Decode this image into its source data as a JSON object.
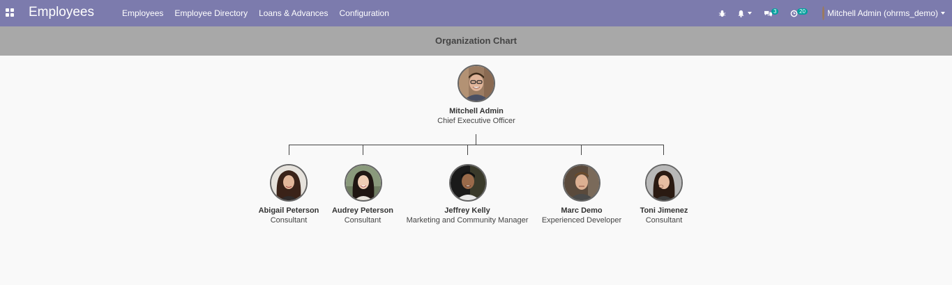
{
  "navbar": {
    "app_title": "Employees",
    "menu": [
      "Employees",
      "Employee Directory",
      "Loans & Advances",
      "Configuration"
    ],
    "messages_count": "3",
    "activities_count": "20",
    "user_label": "Mitchell Admin (ohrms_demo)",
    "icons": [
      "apps-grid-icon",
      "bug-icon",
      "bell-icon",
      "chat-bubbles-icon",
      "clock-icon",
      "user-avatar"
    ]
  },
  "control_panel": {
    "title": "Organization Chart"
  },
  "org_chart": {
    "root": {
      "name": "Mitchell Admin",
      "job": "Chief Executive Officer"
    },
    "children": [
      {
        "name": "Abigail Peterson",
        "job": "Consultant"
      },
      {
        "name": "Audrey Peterson",
        "job": "Consultant"
      },
      {
        "name": "Jeffrey Kelly",
        "job": "Marketing and Community Manager"
      },
      {
        "name": "Marc Demo",
        "job": "Experienced Developer"
      },
      {
        "name": "Toni Jimenez",
        "job": "Consultant"
      }
    ]
  },
  "colors": {
    "navbar": "#7c7bad",
    "control_panel": "#a8a8a8",
    "badge": "#00a09d",
    "page_bg": "#f9f9f9"
  }
}
